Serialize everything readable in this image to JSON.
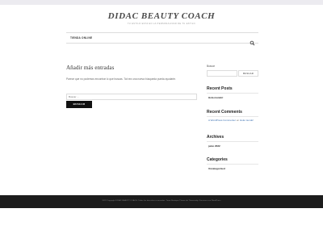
{
  "site": {
    "title": "DIDAC BEAUTY COACH",
    "description": "TU ESTILO ESTA EN LA PERSONALIDAD DE TU ESTILO"
  },
  "nav": {
    "items": [
      "TIENDA ONLINE"
    ],
    "search_icon": "search-icon"
  },
  "main": {
    "title": "Añadir más entradas",
    "text": "Parece que no podemos encontrar lo que buscas. Tal vez una nueva búsqueda pueda ayudarte.",
    "search_placeholder": "Buscar ...",
    "search_button": "BUSCAR"
  },
  "sidebar": {
    "search_label": "Buscar",
    "search_button": "BUSCAR",
    "recent_posts_title": "Recent Posts",
    "recent_posts": [
      "Hola mundo!"
    ],
    "recent_comments_title": "Recent Comments",
    "recent_comment": {
      "author": "A WordPress Commenter",
      "on": "en",
      "post": "Hola mundo!"
    },
    "archives_title": "Archives",
    "archives": [
      "junio 2022"
    ],
    "categories_title": "Categories",
    "categories": [
      "Uncategorized"
    ]
  },
  "footer": {
    "text": "2022 Copyright DIDAC BEAUTY COACH. Todos los derechos reservados. Tema Boutique Theme de Themeruby. Funciona con WordPress"
  },
  "colors": {
    "footer_bg": "#1c1c1c",
    "button_bg": "#111111",
    "link": "#3a6fb0"
  }
}
